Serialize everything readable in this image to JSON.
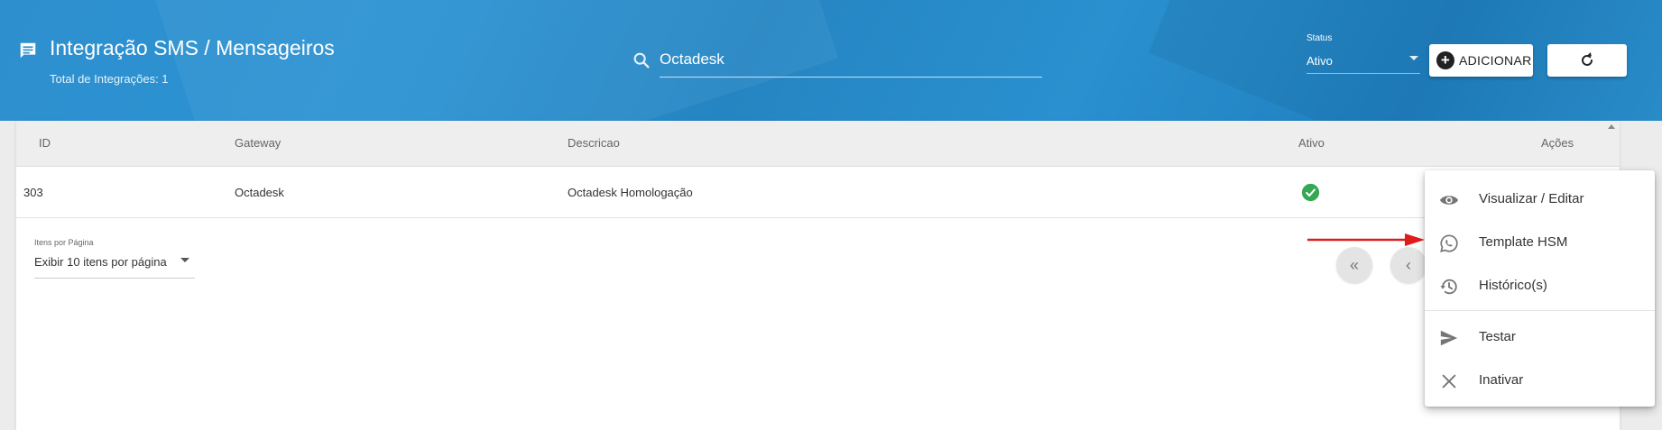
{
  "header": {
    "title": "Integração SMS / Mensageiros",
    "subtitle": "Total de Integrações: 1",
    "title_icon": "message-icon"
  },
  "search": {
    "value": "Octadesk",
    "icon": "search-icon"
  },
  "status_filter": {
    "label": "Status",
    "value": "Ativo"
  },
  "toolbar": {
    "add_label": "ADICIONAR",
    "refresh_icon": "refresh-icon"
  },
  "table": {
    "columns": [
      "ID",
      "Gateway",
      "Descricao",
      "Ativo",
      "Ações"
    ],
    "rows": [
      {
        "id": "303",
        "gateway": "Octadesk",
        "descricao": "Octadesk Homologação",
        "ativo": true
      }
    ]
  },
  "pagination": {
    "per_page_label": "Itens por Página",
    "per_page_value": "Exibir 10 itens por página"
  },
  "context_menu": {
    "items": [
      {
        "label": "Visualizar / Editar",
        "icon": "eye-icon"
      },
      {
        "label": "Template HSM",
        "icon": "whatsapp-icon"
      },
      {
        "label": "Histórico(s)",
        "icon": "history-icon"
      },
      {
        "label": "Testar",
        "icon": "send-icon"
      },
      {
        "label": "Inativar",
        "icon": "close-icon"
      }
    ]
  },
  "colors": {
    "header_blue": "#2b8fcf",
    "active_green": "#35a853",
    "annotation_red": "#e01b1b"
  }
}
